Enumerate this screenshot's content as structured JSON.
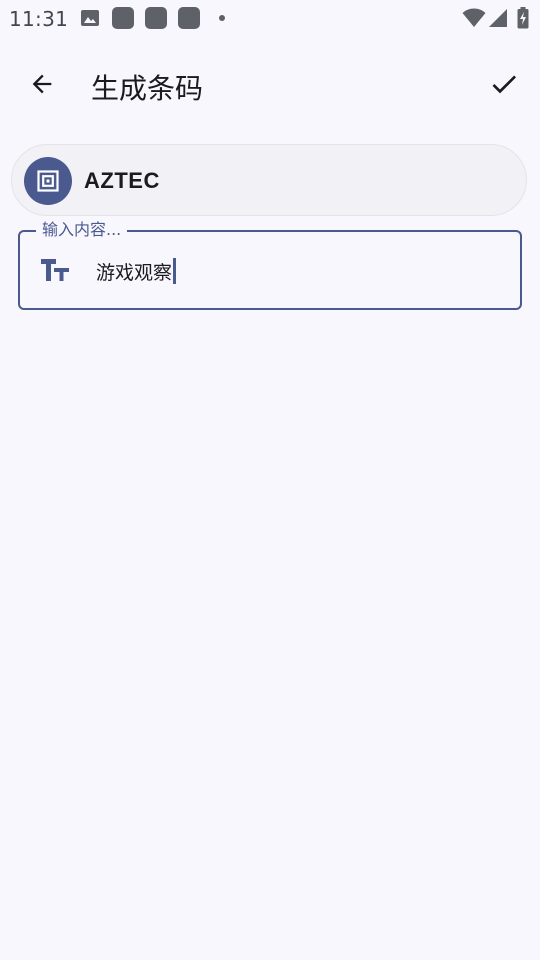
{
  "status_bar": {
    "time": "11:31",
    "icons": [
      "image-icon",
      "app-icon",
      "app-icon",
      "app-icon",
      "dot-icon",
      "wifi-icon",
      "signal-icon",
      "battery-charging-icon"
    ]
  },
  "app_bar": {
    "title": "生成条码",
    "back_icon": "arrow-back-icon",
    "confirm_icon": "check-icon"
  },
  "barcode_type": {
    "label": "AZTEC",
    "icon": "aztec-code-icon"
  },
  "content_field": {
    "label": "输入内容...",
    "value": "游戏观察",
    "icon": "text-fields-icon"
  },
  "colors": {
    "primary": "#4b5a8e",
    "background": "#f8f7fd",
    "surface": "#f1f1f6",
    "on_surface": "#1b1b1f"
  }
}
